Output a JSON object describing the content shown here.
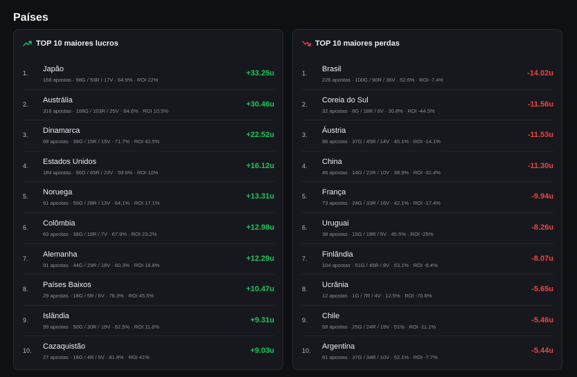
{
  "page_title": "Países",
  "colors": {
    "positive": "#22c55e",
    "negative": "#ef4444"
  },
  "profits": {
    "title": "TOP 10 maiores lucros",
    "icon": "trending-up-icon",
    "rows": [
      {
        "rank": "1.",
        "name": "Japão",
        "stats": "168 apostas · 98G / 53R / 17V · 64.9% · ROI 22%",
        "value": "+33.25u"
      },
      {
        "rank": "2.",
        "name": "Austrália",
        "stats": "316 apostas · 188G / 103R / 25V · 64.6% · ROI 10.5%",
        "value": "+30.46u"
      },
      {
        "rank": "3.",
        "name": "Dinamarca",
        "stats": "68 apostas · 38G / 15R / 15V · 71.7% · ROI 42.5%",
        "value": "+22.52u"
      },
      {
        "rank": "4.",
        "name": "Estados Unidos",
        "stats": "184 apostas · 96G / 65R / 23V · 59.6% · ROI 10%",
        "value": "+16.12u"
      },
      {
        "rank": "5.",
        "name": "Noruega",
        "stats": "91 apostas · 50G / 28R / 13V · 64.1% · ROI 17.1%",
        "value": "+13.31u"
      },
      {
        "rank": "6.",
        "name": "Colômbia",
        "stats": "63 apostas · 38G / 18R / 7V · 67.9% · ROI 23.2%",
        "value": "+12.98u"
      },
      {
        "rank": "7.",
        "name": "Alemanha",
        "stats": "91 apostas · 44G / 29R / 18V · 60.3% · ROI 16.8%",
        "value": "+12.29u"
      },
      {
        "rank": "8.",
        "name": "Países Baixos",
        "stats": "29 apostas · 18G / 5R / 6V · 78.3% · ROI 45.5%",
        "value": "+10.47u"
      },
      {
        "rank": "9.",
        "name": "Islândia",
        "stats": "99 apostas · 50G / 30R / 19V · 62.5% · ROI 11.6%",
        "value": "+9.31u"
      },
      {
        "rank": "10.",
        "name": "Cazaquistão",
        "stats": "27 apostas · 18G / 4R / 5V · 81.8% · ROI 41%",
        "value": "+9.03u"
      }
    ]
  },
  "losses": {
    "title": "TOP 10 maiores perdas",
    "icon": "trending-down-icon",
    "rows": [
      {
        "rank": "1.",
        "name": "Brasil",
        "stats": "226 apostas · 100G / 90R / 36V · 52.6% · ROI -7.4%",
        "value": "-14.02u"
      },
      {
        "rank": "2.",
        "name": "Coreia do Sul",
        "stats": "32 apostas · 8G / 18R / 6V · 30.8% · ROI -44.5%",
        "value": "-11.56u"
      },
      {
        "rank": "3.",
        "name": "Áustria",
        "stats": "96 apostas · 37G / 45R / 14V · 45.1% · ROI -14.1%",
        "value": "-11.53u"
      },
      {
        "rank": "4.",
        "name": "China",
        "stats": "46 apostas · 14G / 22R / 10V · 38.9% · ROI -31.4%",
        "value": "-11.30u"
      },
      {
        "rank": "5.",
        "name": "França",
        "stats": "73 apostas · 24G / 33R / 16V · 42.1% · ROI -17.4%",
        "value": "-9.94u"
      },
      {
        "rank": "6.",
        "name": "Uruguai",
        "stats": "38 apostas · 15G / 18R / 5V · 45.5% · ROI -25%",
        "value": "-8.26u"
      },
      {
        "rank": "7.",
        "name": "Finlândia",
        "stats": "104 apostas · 51G / 45R / 8V · 53.1% · ROI -8.4%",
        "value": "-8.07u"
      },
      {
        "rank": "8.",
        "name": "Ucrânia",
        "stats": "12 apostas · 1G / 7R / 4V · 12.5% · ROI -70.6%",
        "value": "-5.65u"
      },
      {
        "rank": "9.",
        "name": "Chile",
        "stats": "68 apostas · 25G / 24R / 19V · 51% · ROI -11.1%",
        "value": "-5.46u"
      },
      {
        "rank": "10.",
        "name": "Argentina",
        "stats": "81 apostas · 37G / 34R / 10V · 52.1% · ROI -7.7%",
        "value": "-5.44u"
      }
    ]
  }
}
